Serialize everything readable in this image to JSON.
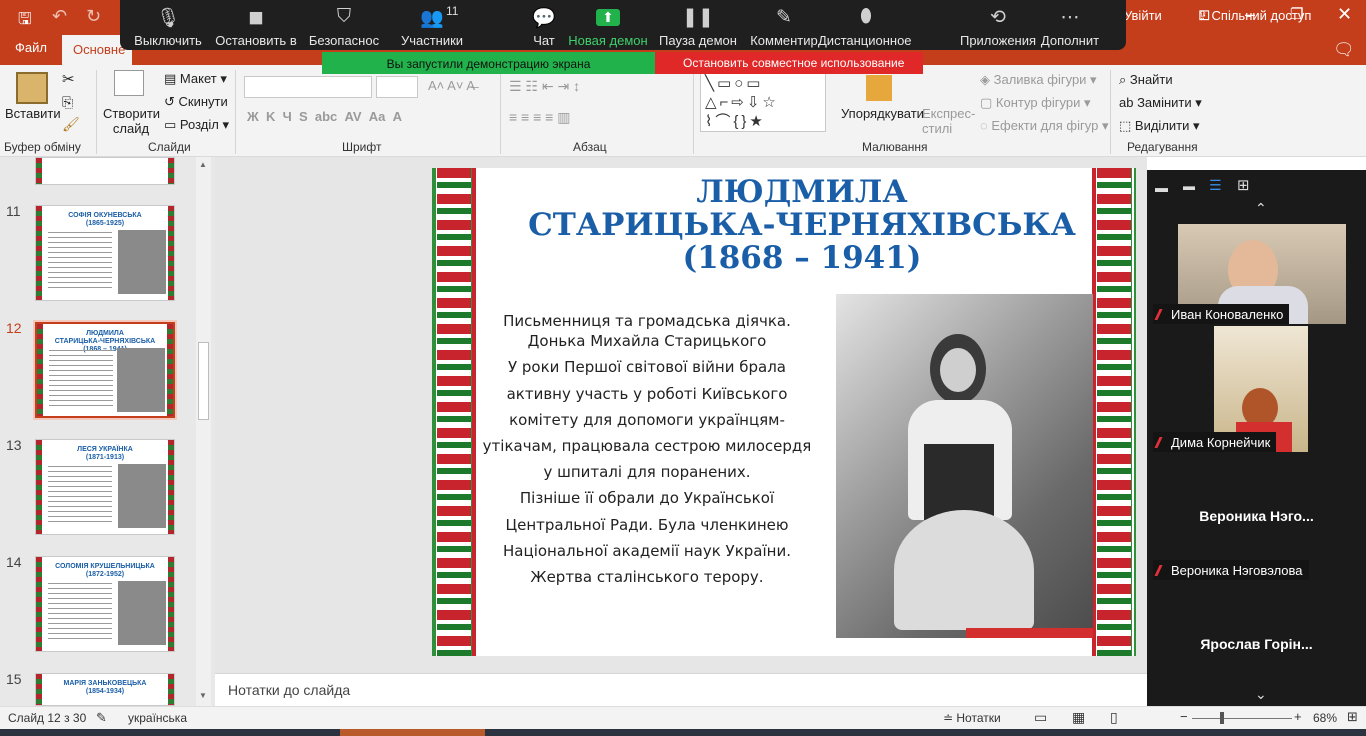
{
  "titlebar": {
    "account_btn": "Увійти"
  },
  "tabs": {
    "file": "Файл",
    "home": "Основне"
  },
  "share": "Спільний доступ",
  "ribbon": {
    "paste": "Вставити",
    "clipboard": "Буфер обміну",
    "new_slide": "Створити слайд",
    "layout": "Макет",
    "reset": "Скинути",
    "section": "Розділ",
    "slides": "Слайди",
    "font": "Шрифт",
    "paragraph": "Абзац",
    "arrange": "Упорядкувати",
    "quick_styles": "Експрес-стилі",
    "fill": "Заливка фігури",
    "outline": "Контур фігури",
    "effects": "Ефекти для фігур",
    "drawing": "Малювання",
    "find": "Знайти",
    "replace": "Замінити",
    "select": "Виділити",
    "editing": "Редагування"
  },
  "zoom": {
    "items": [
      {
        "icon": "mic-icon",
        "label": "Выключить"
      },
      {
        "icon": "video-icon",
        "label": "Остановить в"
      },
      {
        "icon": "shield-icon",
        "label": "Безопаснос"
      },
      {
        "icon": "participants-icon",
        "label": "Участники",
        "count": "11"
      },
      {
        "icon": "chat-icon",
        "label": "Чат"
      },
      {
        "icon": "share-screen-icon",
        "label": "Новая демон"
      },
      {
        "icon": "pause-icon",
        "label": "Пауза демон"
      },
      {
        "icon": "annotate-icon",
        "label": "Комментир"
      },
      {
        "icon": "remote-control-icon",
        "label": "Дистанционное у"
      },
      {
        "icon": "apps-icon",
        "label": "Приложения"
      },
      {
        "icon": "more-icon",
        "label": "Дополнит"
      }
    ],
    "sharing_banner": "Вы запустили демонстрацию экрана",
    "stop_share": "Остановить совместное использование"
  },
  "thumbs": [
    {
      "num": "11",
      "title": "СОФІЯ ОКУНЕВСЬКА\n(1865-1925)"
    },
    {
      "num": "12",
      "title": "ЛЮДМИЛА\nСТАРИЦЬКА-ЧЕРНЯХІВСЬКА\n(1868 – 1941)"
    },
    {
      "num": "13",
      "title": "ЛЕСЯ УКРАЇНКА\n(1871-1913)"
    },
    {
      "num": "14",
      "title": "СОЛОМІЯ КРУШЕЛЬНИЦЬКА\n(1872-1952)"
    },
    {
      "num": "15",
      "title": "МАРІЯ ЗАНЬКОВЕЦЬКА\n(1854-1934)"
    }
  ],
  "slide": {
    "title": "ЛЮДМИЛА\nСТАРИЦЬКА-ЧЕРНЯХІВСЬКА\n(1868 – 1941)",
    "body": [
      "Письменниця та громадська діячка.",
      "Донька Михайла Старицького",
      "У роки Першої світової війни брала",
      "активну участь у роботі Київського",
      "комітету для допомоги українцям-",
      "утікачам, працювала сестрою милосердя",
      "у шпиталі для поранених.",
      "Пізніше її обрали до Української",
      "Центральної Ради. Була членкинею",
      "Національної академії наук України.",
      "Жертва сталінського терору."
    ]
  },
  "notes": "Нотатки до слайда",
  "status": {
    "slide": "Слайд 12 з 30",
    "lang": "українська",
    "notes": "Нотатки",
    "zoom": "68%"
  },
  "participants": [
    {
      "name": "Иван Коноваленко"
    },
    {
      "name": "Дима Корнейчик"
    },
    {
      "big": "Вероника  Нэго...",
      "name": "Вероника Нэговэлова"
    },
    {
      "big": "Ярослав  Горін..."
    }
  ]
}
